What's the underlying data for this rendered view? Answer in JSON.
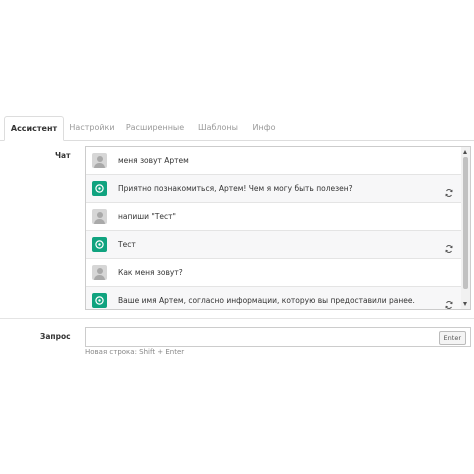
{
  "tabs": [
    {
      "label": "Ассистент",
      "active": true
    },
    {
      "label": "Настройки",
      "active": false
    },
    {
      "label": "Расширенные",
      "active": false
    },
    {
      "label": "Шаблоны",
      "active": false
    },
    {
      "label": "Инфо",
      "active": false
    }
  ],
  "chat": {
    "label": "Чат",
    "messages": [
      {
        "role": "user",
        "text": "меня зовут Артем"
      },
      {
        "role": "assistant",
        "text": "Приятно познакомиться, Артем! Чем я могу быть полезен?"
      },
      {
        "role": "user",
        "text": "напиши \"Тест\""
      },
      {
        "role": "assistant",
        "text": "Тест"
      },
      {
        "role": "user",
        "text": "Как меня зовут?"
      },
      {
        "role": "assistant",
        "text": "Ваше имя Артем, согласно информации, которую вы предоставили ранее."
      }
    ],
    "regenerate_icon": "refresh-icon",
    "user_avatar_icon": "user-avatar-icon",
    "assistant_avatar_icon": "openai-logo-icon"
  },
  "query": {
    "label": "Запрос",
    "value": "",
    "enter_button": "Enter",
    "hint": "Новая строка: Shift + Enter"
  },
  "colors": {
    "assistant_avatar": "#10a37f",
    "assistant_row": "#f7f7f8",
    "border": "#cccccc"
  }
}
